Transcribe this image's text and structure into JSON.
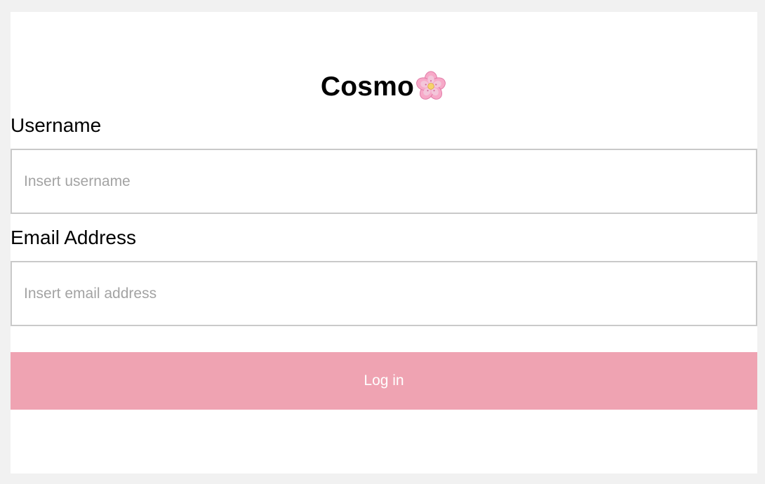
{
  "header": {
    "title": "Cosmo",
    "logo_icon": "cherry-blossom-icon"
  },
  "form": {
    "username": {
      "label": "Username",
      "placeholder": "Insert username",
      "value": ""
    },
    "email": {
      "label": "Email Address",
      "placeholder": "Insert email address",
      "value": ""
    },
    "submit_label": "Log in"
  },
  "colors": {
    "page_background": "#f1f1f1",
    "card_background": "#ffffff",
    "button_background": "#efa3b2",
    "button_text": "#ffffff",
    "input_border": "#c9c9c9",
    "placeholder_text": "#a3a3a3",
    "flower_petal": "#f7a9c8"
  }
}
